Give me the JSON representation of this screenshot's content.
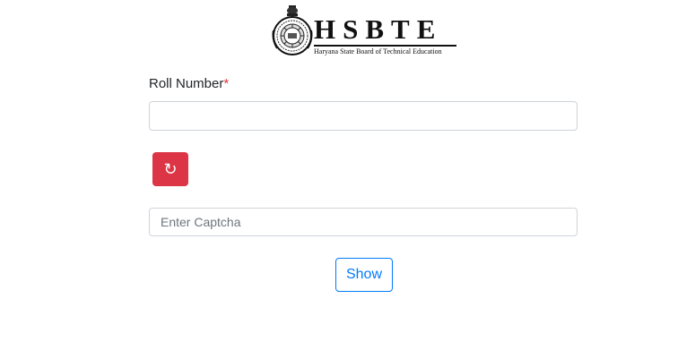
{
  "header": {
    "logo_title": "HSBTE",
    "logo_subtitle": "Haryana State Board of Technical Education",
    "emblem_icon": "hsbte-emblem-icon"
  },
  "form": {
    "roll_label": "Roll Number",
    "required_mark": "*",
    "roll_value": "",
    "refresh_icon": "refresh-icon",
    "refresh_glyph": "↻",
    "captcha_placeholder": "Enter Captcha",
    "captcha_value": "",
    "show_label": "Show"
  },
  "colors": {
    "refresh_button": "#dc3545",
    "required_mark": "#dc3545",
    "show_button_border": "#007bff",
    "show_button_text": "#007bff",
    "input_border": "#ced4da"
  }
}
